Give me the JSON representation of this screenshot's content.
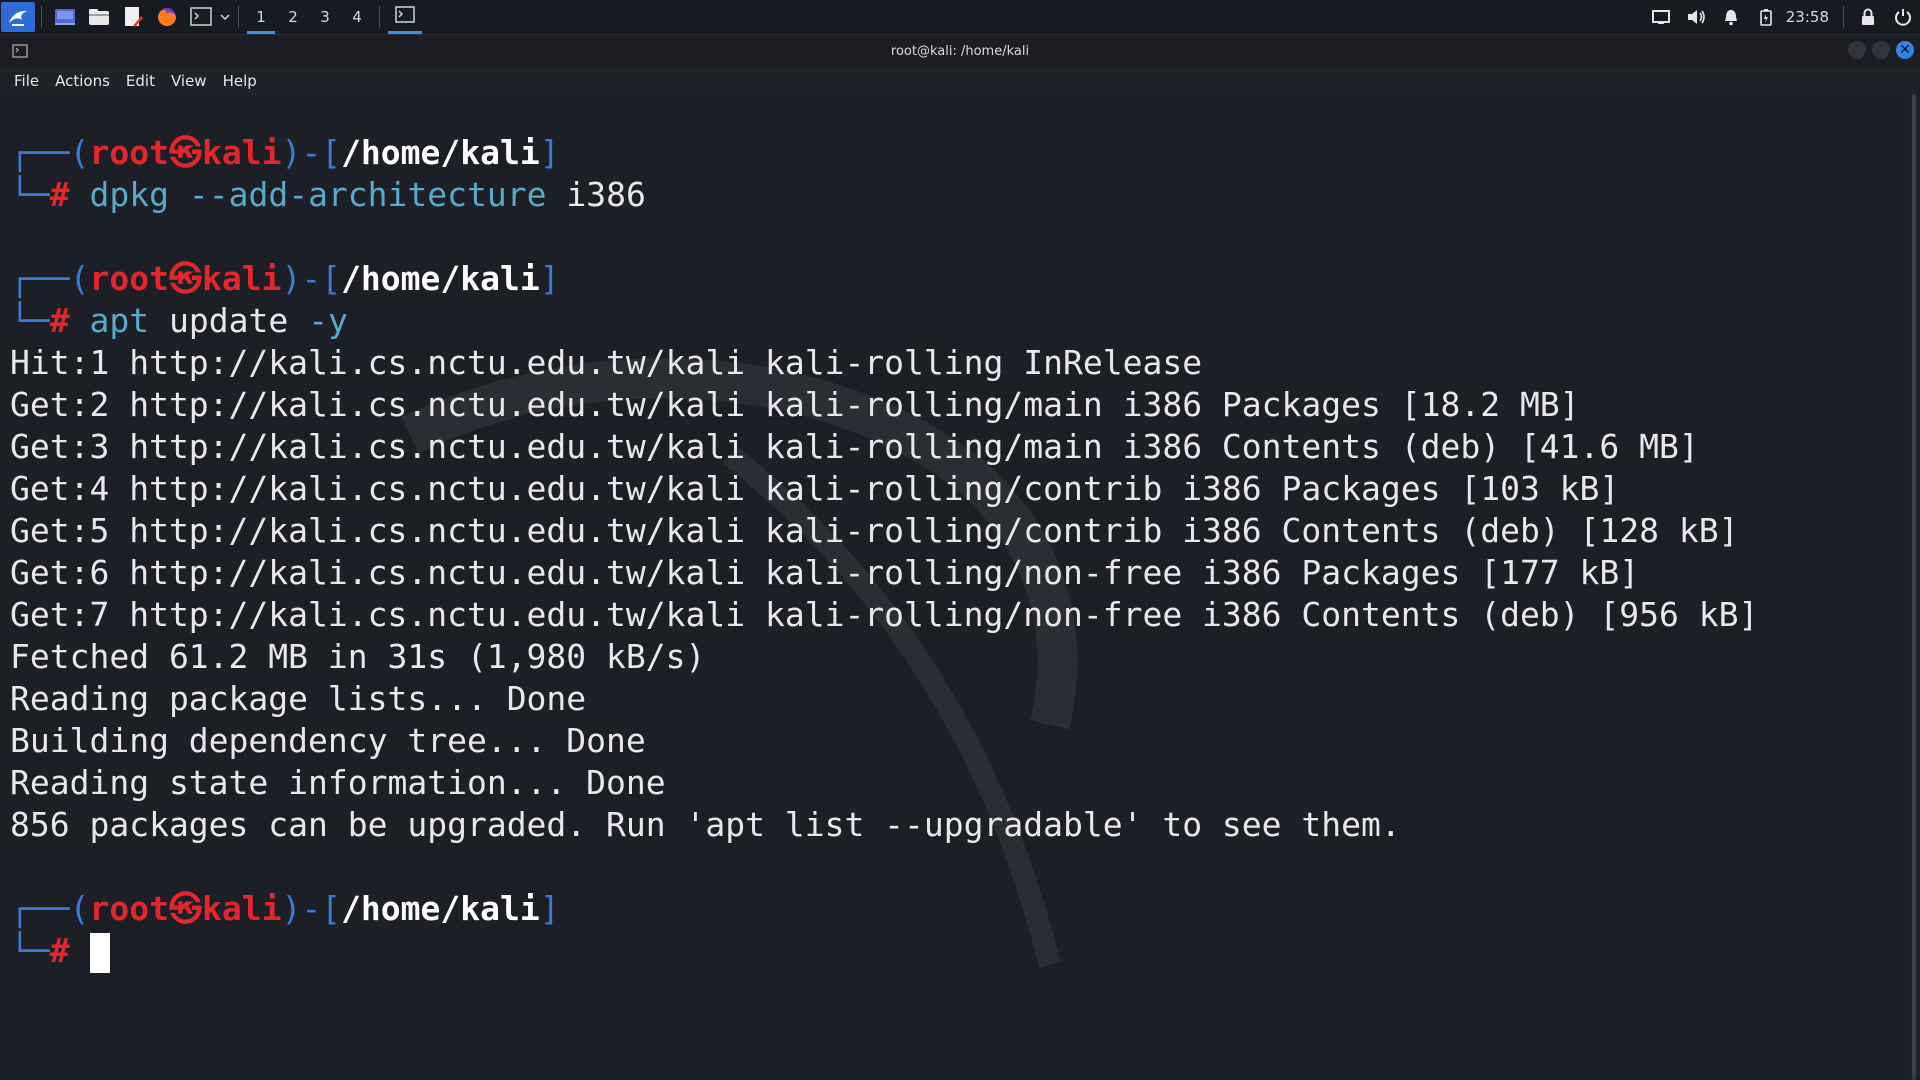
{
  "panel": {
    "workspaces": [
      "1",
      "2",
      "3",
      "4"
    ],
    "active_workspace": "1",
    "clock": "23:58",
    "icons": [
      "kali-menu-icon",
      "desktop-icon",
      "file-manager-icon",
      "text-editor-icon",
      "firefox-icon",
      "terminal-icon",
      "chevron-down-icon",
      "terminal-task-icon",
      "display-icon",
      "volume-icon",
      "notification-bell-icon",
      "battery-icon",
      "lock-icon",
      "power-icon"
    ]
  },
  "window": {
    "title": "root@kali: /home/kali"
  },
  "menu": [
    "File",
    "Actions",
    "Edit",
    "View",
    "Help"
  ],
  "prompt": {
    "user": "root",
    "host": "kali",
    "dir": "/home/kali",
    "symbol": "#"
  },
  "commands": {
    "cmd1": {
      "program": "dpkg",
      "option": "--add-architecture",
      "arg": "i386"
    },
    "cmd2": {
      "program": "apt",
      "arg": "update",
      "option": "-y"
    }
  },
  "output": [
    "Hit:1 http://kali.cs.nctu.edu.tw/kali kali-rolling InRelease",
    "Get:2 http://kali.cs.nctu.edu.tw/kali kali-rolling/main i386 Packages [18.2 MB]",
    "Get:3 http://kali.cs.nctu.edu.tw/kali kali-rolling/main i386 Contents (deb) [41.6 MB]",
    "Get:4 http://kali.cs.nctu.edu.tw/kali kali-rolling/contrib i386 Packages [103 kB]",
    "Get:5 http://kali.cs.nctu.edu.tw/kali kali-rolling/contrib i386 Contents (deb) [128 kB]",
    "Get:6 http://kali.cs.nctu.edu.tw/kali kali-rolling/non-free i386 Packages [177 kB]",
    "Get:7 http://kali.cs.nctu.edu.tw/kali kali-rolling/non-free i386 Contents (deb) [956 kB]",
    "Fetched 61.2 MB in 31s (1,980 kB/s)",
    "Reading package lists... Done",
    "Building dependency tree... Done",
    "Reading state information... Done",
    "856 packages can be upgraded. Run 'apt list --upgradable' to see them."
  ],
  "colors": {
    "accent": "#2f83e6",
    "prompt_red": "#e2262b",
    "prompt_blue": "#3a7bd5",
    "command_cyan": "#59a9c8",
    "background": "#1c1f26"
  }
}
